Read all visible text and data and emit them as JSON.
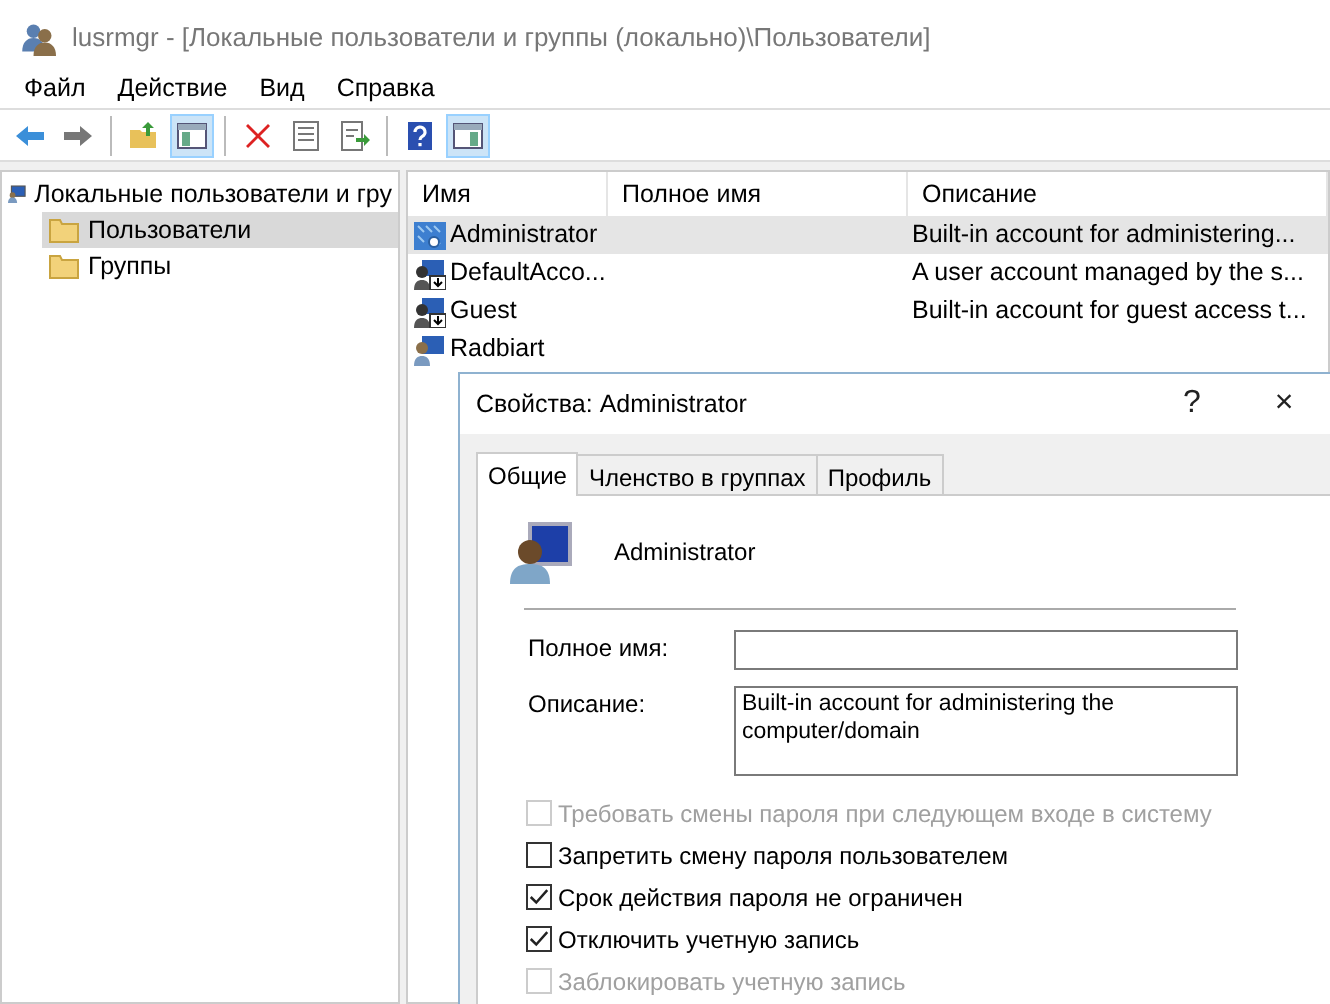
{
  "window": {
    "title": "lusrmgr - [Локальные пользователи и группы (локально)\\Пользователи]"
  },
  "menu": [
    "Файл",
    "Действие",
    "Вид",
    "Справка"
  ],
  "toolbar": [
    {
      "kind": "back",
      "pressed": false
    },
    {
      "kind": "forward",
      "pressed": false
    },
    {
      "kind": "separator"
    },
    {
      "kind": "up",
      "pressed": false
    },
    {
      "kind": "tree",
      "pressed": true
    },
    {
      "kind": "separator"
    },
    {
      "kind": "delete",
      "pressed": false
    },
    {
      "kind": "properties",
      "pressed": false
    },
    {
      "kind": "export",
      "pressed": false
    },
    {
      "kind": "separator"
    },
    {
      "kind": "help",
      "pressed": false
    },
    {
      "kind": "actionpane",
      "pressed": true
    }
  ],
  "tree": [
    {
      "label": "Локальные пользователи и гру",
      "kind": "computer",
      "selected": false,
      "children": [
        {
          "label": "Пользователи",
          "kind": "folder",
          "selected": true
        },
        {
          "label": "Группы",
          "kind": "folder",
          "selected": false
        }
      ]
    }
  ],
  "table": {
    "columns": [
      "Имя",
      "Полное имя",
      "Описание"
    ],
    "rows": [
      {
        "kind": "admin",
        "selected": true,
        "cells": [
          "Administrator",
          null,
          "Built-in account for administering..."
        ]
      },
      {
        "kind": "disabled",
        "selected": false,
        "cells": [
          "DefaultAcco...",
          null,
          "A user account managed by the s..."
        ]
      },
      {
        "kind": "disabled",
        "selected": false,
        "cells": [
          "Guest",
          null,
          "Built-in account for guest access t..."
        ]
      },
      {
        "kind": "user",
        "selected": false,
        "cells": [
          "Radbiart"
        ]
      }
    ]
  },
  "dialog": {
    "title": "Свойства: Administrator",
    "help": "?",
    "close": "×",
    "tabs": [
      {
        "label": "Общие",
        "selected": true
      },
      {
        "label": "Членство в группах",
        "selected": false
      },
      {
        "label": "Профиль",
        "selected": false
      }
    ],
    "user_name": "Administrator",
    "fields": [
      {
        "label": "Полное имя:",
        "multiline": false
      },
      {
        "label": "Описание:",
        "value": "Built-in account for administering the computer/domain",
        "multiline": true
      }
    ],
    "checkboxes": [
      {
        "label": "Требовать смены пароля при следующем входе в систему",
        "checked": false,
        "disabled": true
      },
      {
        "label": "Запретить смену пароля пользователем",
        "checked": false,
        "disabled": false
      },
      {
        "label": "Срок действия пароля не ограничен",
        "checked": true,
        "disabled": false
      },
      {
        "label": "Отключить учетную запись",
        "checked": true,
        "disabled": false
      },
      {
        "label": "Заблокировать учетную запись",
        "checked": false,
        "disabled": true
      }
    ]
  }
}
